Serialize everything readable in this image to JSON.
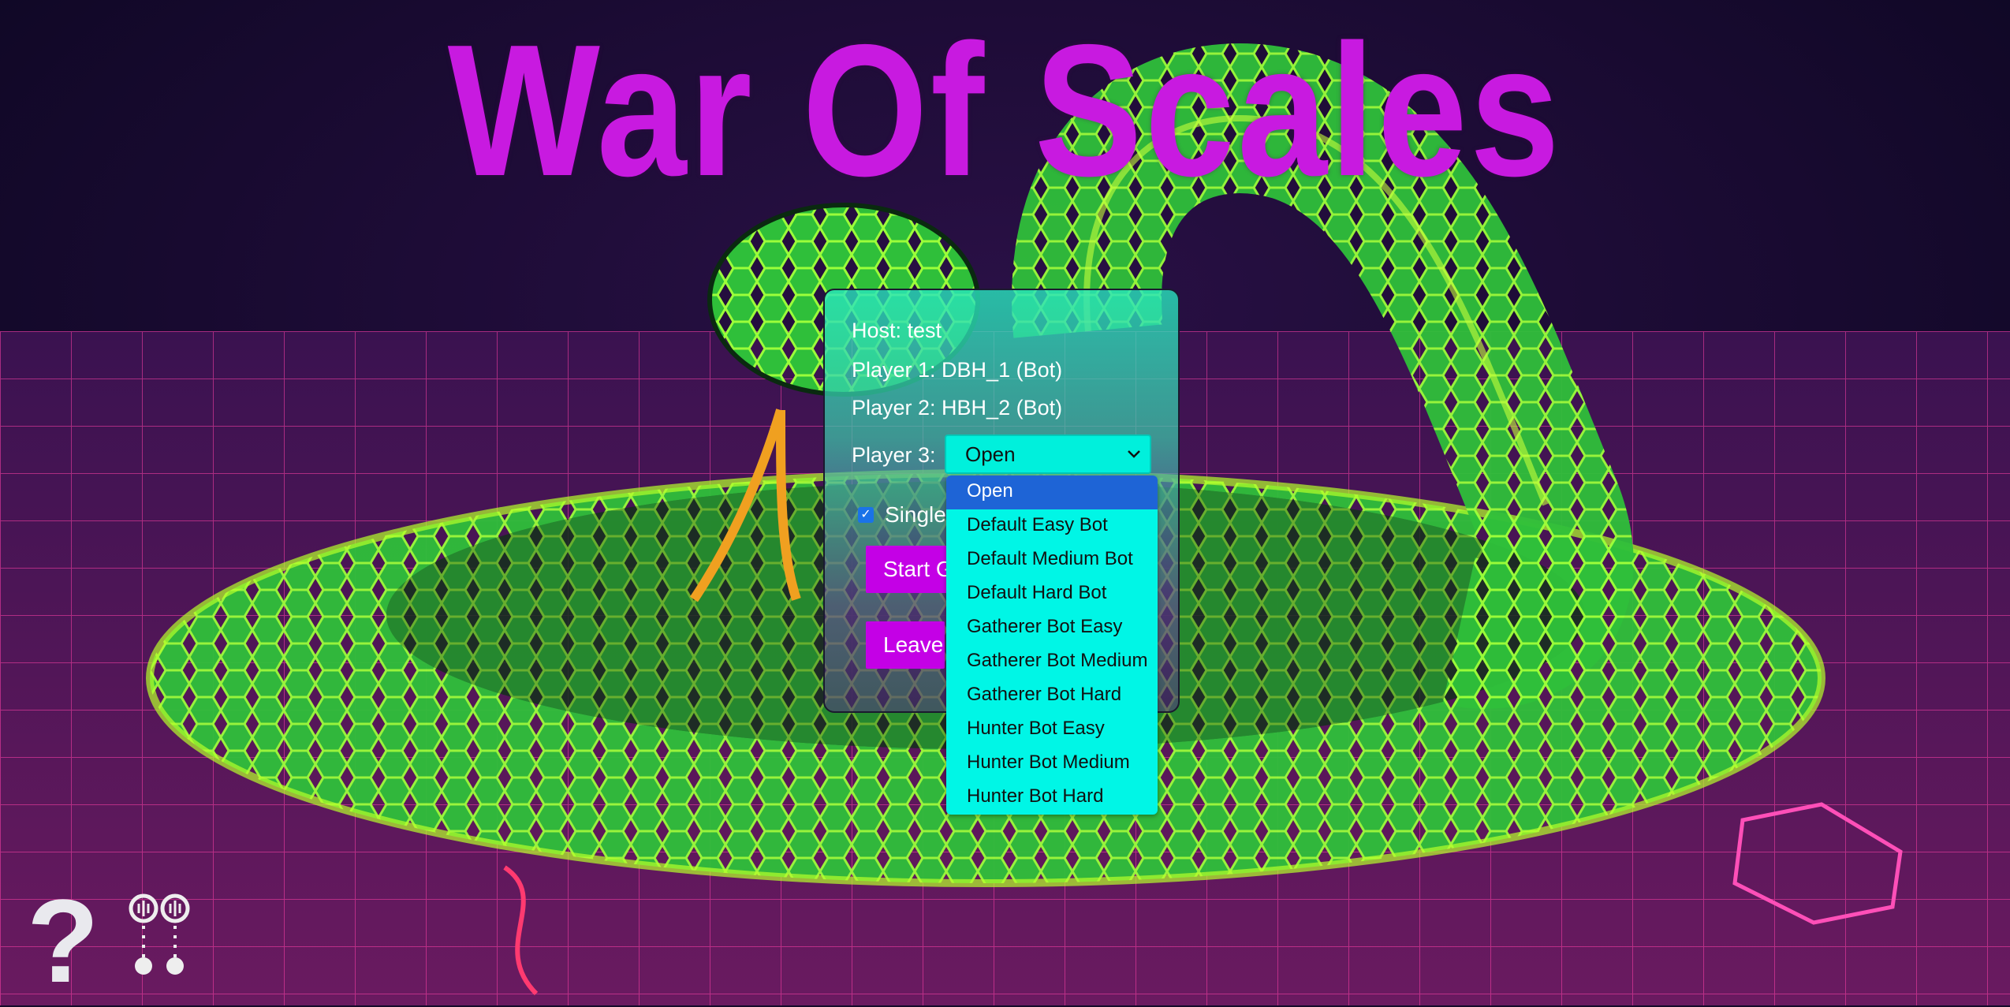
{
  "app": {
    "title": "War Of Scales"
  },
  "lobby": {
    "host": "Host: test",
    "player1": "Player 1: DBH_1 (Bot)",
    "player2": "Player 2: HBH_2 (Bot)",
    "player3_label": "Player 3:",
    "player3_select": {
      "value": "Open",
      "options": [
        "Open",
        "Default Easy Bot",
        "Default Medium Bot",
        "Default Hard Bot",
        "Gatherer Bot Easy",
        "Gatherer Bot Medium",
        "Gatherer Bot Hard",
        "Hunter Bot Easy",
        "Hunter Bot Medium",
        "Hunter Bot Hard"
      ]
    },
    "single_label": "Single",
    "single_checked": true,
    "start_button": "Start G",
    "leave_button": "Leave"
  },
  "footer": {
    "help_icon": "question-mark",
    "help_glyph": "?",
    "audio_icon": "audio-toggle"
  },
  "colors": {
    "title": "#c81ae0",
    "select_bg": "#00f0dc",
    "highlight": "#1e64d6",
    "button": "#c400e6"
  }
}
